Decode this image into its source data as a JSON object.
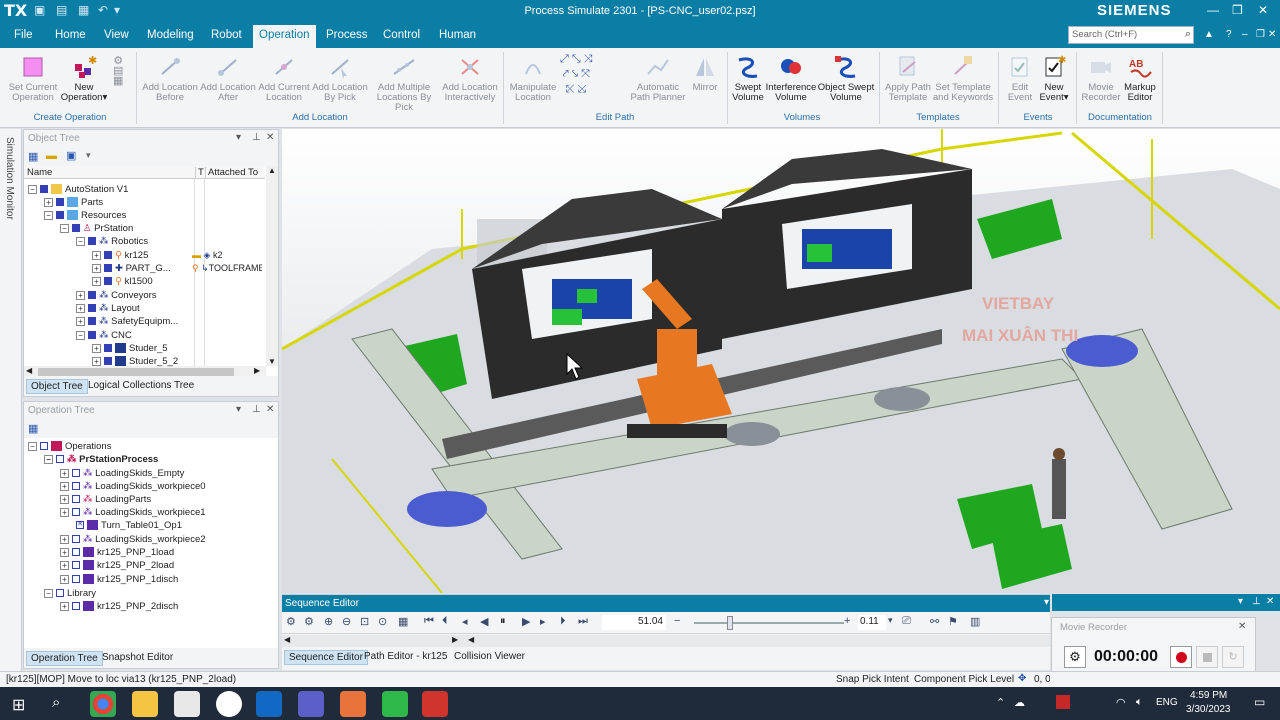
{
  "titlebar": {
    "logo": "TX",
    "window_title": "Process Simulate 2301 - [PS-CNC_user02.psz]",
    "brand": "SIEMENS"
  },
  "menu": {
    "items": [
      "File",
      "Home",
      "View",
      "Modeling",
      "Robot",
      "Operation",
      "Process",
      "Control",
      "Human"
    ],
    "active": "Operation",
    "search_placeholder": "Search (Ctrl+F)"
  },
  "ribbon": {
    "groups": [
      {
        "label": "Create Operation",
        "buttons": [
          {
            "label1": "Set Current",
            "label2": "Operation",
            "enabled": false
          },
          {
            "label1": "New",
            "label2": "Operation",
            "enabled": true
          }
        ]
      },
      {
        "label": "Add Location",
        "buttons": [
          {
            "label1": "Add Location",
            "label2": "Before",
            "enabled": false
          },
          {
            "label1": "Add Location",
            "label2": "After",
            "enabled": false
          },
          {
            "label1": "Add Current",
            "label2": "Location",
            "enabled": false
          },
          {
            "label1": "Add Location",
            "label2": "By Pick",
            "enabled": false
          },
          {
            "label1": "Add Multiple",
            "label2": "Locations By Pick",
            "enabled": false
          },
          {
            "label1": "Add Location",
            "label2": "Interactively",
            "enabled": false
          }
        ]
      },
      {
        "label": "Edit Path",
        "buttons": [
          {
            "label1": "Manipulate",
            "label2": "Location",
            "enabled": false
          },
          {
            "label1": "Automatic",
            "label2": "Path Planner",
            "enabled": false
          },
          {
            "label1": "Mirror",
            "label2": "",
            "enabled": false
          }
        ]
      },
      {
        "label": "Volumes",
        "buttons": [
          {
            "label1": "Swept",
            "label2": "Volume",
            "enabled": true
          },
          {
            "label1": "Interference",
            "label2": "Volume",
            "enabled": true
          },
          {
            "label1": "Object Swept",
            "label2": "Volume",
            "enabled": true
          }
        ]
      },
      {
        "label": "Templates",
        "buttons": [
          {
            "label1": "Apply Path",
            "label2": "Template",
            "enabled": false
          },
          {
            "label1": "Set Template",
            "label2": "and Keywords",
            "enabled": false
          }
        ]
      },
      {
        "label": "Events",
        "buttons": [
          {
            "label1": "Edit",
            "label2": "Event",
            "enabled": false
          },
          {
            "label1": "New",
            "label2": "Event",
            "enabled": true
          }
        ]
      },
      {
        "label": "Documentation",
        "buttons": [
          {
            "label1": "Movie",
            "label2": "Recorder",
            "enabled": false
          },
          {
            "label1": "Markup",
            "label2": "Editor",
            "enabled": true
          }
        ]
      }
    ]
  },
  "side": {
    "simulation_monitor": "Simulation Monitor"
  },
  "object_tree": {
    "title": "Object Tree",
    "columns": [
      "Name",
      "T",
      "Attached To"
    ],
    "rows": [
      {
        "name": "AutoStation V1",
        "attached": ""
      },
      {
        "name": "Parts",
        "attached": ""
      },
      {
        "name": "Resources",
        "attached": ""
      },
      {
        "name": "PrStation",
        "attached": ""
      },
      {
        "name": "Robotics",
        "attached": ""
      },
      {
        "name": "kr125",
        "attached": "k2"
      },
      {
        "name": "PART_G...",
        "attached": "TOOLFRAME"
      },
      {
        "name": "kl1500",
        "attached": ""
      },
      {
        "name": "Conveyors",
        "attached": ""
      },
      {
        "name": "Layout",
        "attached": ""
      },
      {
        "name": "SafetyEquipm...",
        "attached": ""
      },
      {
        "name": "CNC",
        "attached": ""
      },
      {
        "name": "Studer_5",
        "attached": ""
      },
      {
        "name": "Studer_5_2",
        "attached": ""
      }
    ],
    "tabs": [
      "Object Tree",
      "Logical Collections Tree"
    ]
  },
  "operation_tree": {
    "title": "Operation Tree",
    "rows": [
      "Operations",
      "PrStationProcess",
      "LoadingSkids_Empty",
      "LoadingSkids_workpiece0",
      "LoadingParts",
      "LoadingSkids_workpiece1",
      "Turn_Table01_Op1",
      "LoadingSkids_workpiece2",
      "kr125_PNP_1load",
      "kr125_PNP_2load",
      "kr125_PNP_1disch",
      "Library",
      "kr125_PNP_2disch"
    ],
    "tabs": [
      "Operation Tree",
      "Snapshot Editor"
    ]
  },
  "viewport": {
    "watermark1": "VIETBAY",
    "watermark2": "MAI XUÂN THI"
  },
  "sequence_editor": {
    "title": "Sequence Editor",
    "time": "51.04",
    "step": "0.11",
    "position_fraction": 0.22,
    "tabs": [
      "Sequence Editor",
      "Path Editor - kr125",
      "Collision Viewer"
    ]
  },
  "movie_recorder": {
    "title": "Movie Recorder",
    "time": "00:00:00"
  },
  "status": {
    "message": "[kr125][MOP] Move to loc via13 (kr125_PNP_2load)",
    "snap": "Snap Pick Intent",
    "pick": "Component Pick Level",
    "coords": "0, 0"
  },
  "taskbar": {
    "lang": "ENG",
    "time": "4:59 PM",
    "date": "3/30/2023"
  },
  "colors": {
    "accent": "#0a7ea4",
    "robot": "#e87722",
    "skid_bin": "#22a32a",
    "rail": "#e8e832"
  }
}
